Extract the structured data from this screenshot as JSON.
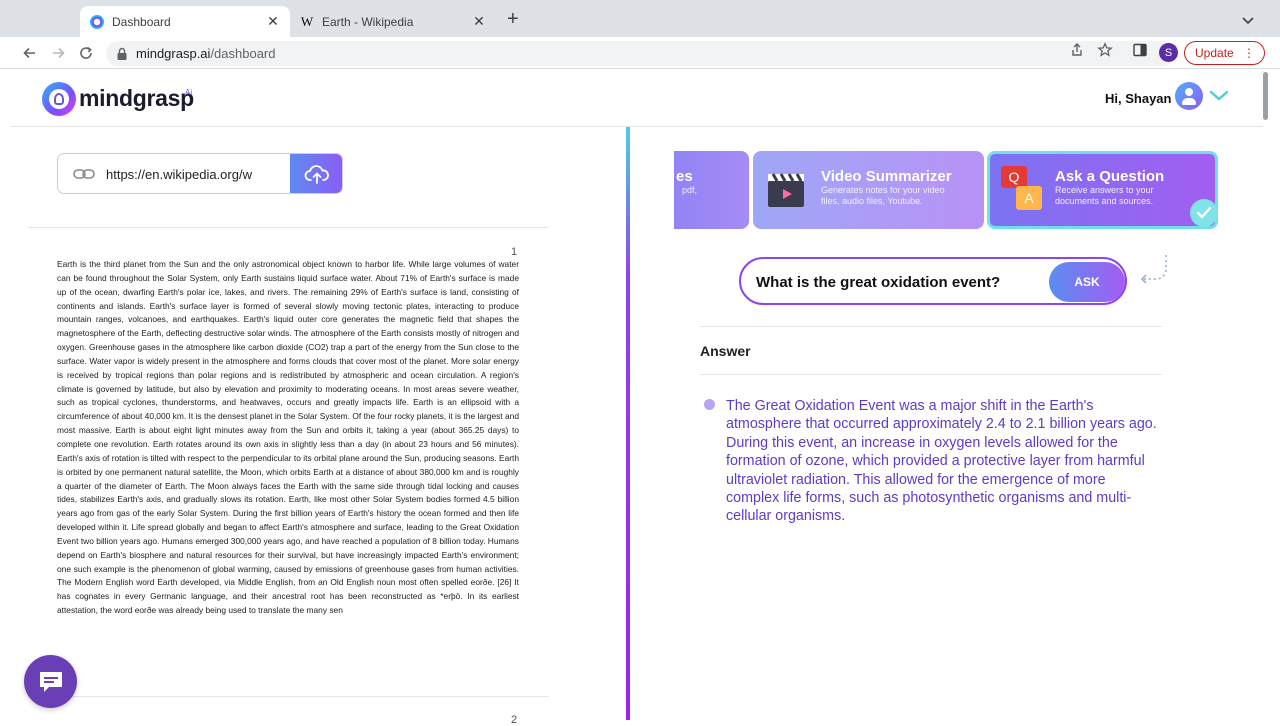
{
  "browser": {
    "tabs": [
      {
        "title": "Dashboard",
        "active": true
      },
      {
        "title": "Earth - Wikipedia",
        "active": false,
        "favicon_letter": "W"
      }
    ],
    "url_host": "mindgrasp.ai",
    "url_path": "/dashboard",
    "profile_initial": "S",
    "update_label": "Update",
    "update_menu": "⋮",
    "new_tab": "+",
    "close_glyph": "✕"
  },
  "header": {
    "logo_text": "mindgrasp",
    "logo_badge": "Ai",
    "greeting": "Hi, Shayan"
  },
  "left": {
    "url_input_value": "https://en.wikipedia.org/w",
    "page_number": "1",
    "next_page_number": "2",
    "document_text": "Earth is the third planet from the Sun and the only astronomical object known to harbor life. While large volumes of water can be found throughout the Solar System, only Earth sustains liquid surface water. About 71% of Earth's surface is made up of the ocean, dwarfing Earth's polar ice, lakes, and rivers. The remaining 29% of Earth's surface is land, consisting of continents and islands. Earth's surface layer is formed of several slowly moving tectonic plates, interacting to produce mountain ranges, volcanoes, and earthquakes. Earth's liquid outer core generates the magnetic field that shapes the magnetosphere of the Earth, deflecting destructive solar winds. The atmosphere of the Earth consists mostly of nitrogen and oxygen. Greenhouse gases in the atmosphere like carbon dioxide (CO2) trap a part of the energy from the Sun close to the surface. Water vapor is widely present in the atmosphere and forms clouds that cover most of the planet. More solar energy is received by tropical regions than polar regions and is redistributed by atmospheric and ocean circulation. A region's climate is governed by latitude, but also by elevation and proximity to moderating oceans. In most areas severe weather, such as tropical cyclones, thunderstorms, and heatwaves, occurs and greatly impacts life. Earth is an ellipsoid with a circumference of about 40,000 km. It is the densest planet in the Solar System. Of the four rocky planets, it is the largest and most massive. Earth is about eight light minutes away from the Sun and orbits it, taking a year (about 365.25 days) to complete one revolution. Earth rotates around its own axis in slightly less than a day (in about 23 hours and 56 minutes). Earth's axis of rotation is tilted with respect to the perpendicular to its orbital plane around the Sun, producing seasons. Earth is orbited by one permanent natural satellite, the Moon, which orbits Earth at a distance of about 380,000 km and is roughly a quarter of the diameter of Earth. The Moon always faces the Earth with the same side through tidal locking and causes tides, stabilizes Earth's axis, and gradually slows its rotation. Earth, like most other Solar System bodies formed 4.5 billion years ago from gas of the early Solar System. During the first billion years of Earth's history the ocean formed and then life developed within it. Life spread globally and began to affect Earth's atmosphere and surface, leading to the Great Oxidation Event two billion years ago. Humans emerged 300,000 years ago, and have reached a population of 8 billion today. Humans depend on Earth's biosphere and natural resources for their survival, but have increasingly impacted Earth's environment; one such example is the phenomenon of global warming, caused by emissions of greenhouse gases from human activities. The Modern English word Earth developed, via Middle English, from an Old English noun most often spelled eorðe. [26] It has cognates in every Germanic language, and their ancestral root has been reconstructed as *erþō. In its earliest attestation, the word eorðe was already being used to translate the many sen"
  },
  "tools": [
    {
      "title": "es",
      "description": "pdf,",
      "partial": true
    },
    {
      "title": "Video Summarizer",
      "description": "Generates notes for your video files, audio files, Youtube."
    },
    {
      "title": "Ask a Question",
      "description": "Receive answers to your documents and sources.",
      "selected": true,
      "icon_q": "Q",
      "icon_a": "A"
    }
  ],
  "ask": {
    "question": "What is the great oxidation event?",
    "button_label": "ASK"
  },
  "answer": {
    "heading": "Answer",
    "text": "The Great Oxidation Event was a major shift in the Earth's atmosphere that occurred approximately 2.4 to 2.1 billion years ago. During this event, an increase in oxygen levels allowed for the formation of ozone, which provided a protective layer from harmful ultraviolet radiation. This allowed for the emergence of more complex life forms, such as photosynthetic organisms and multi-cellular organisms."
  },
  "colors": {
    "accent_purple": "#8e44ec",
    "answer_text": "#5e3bc7",
    "update_red": "#c5221f",
    "chat_fab": "#6a3fb5"
  },
  "icons": [
    "dashboard-favicon",
    "wikipedia-favicon",
    "back-arrow-icon",
    "forward-arrow-icon",
    "reload-icon",
    "lock-icon",
    "share-icon",
    "star-icon",
    "sidebar-icon",
    "link-icon",
    "cloud-upload-icon",
    "chat-icon",
    "clapperboard-icon",
    "qa-icon",
    "check-icon",
    "chevron-down-icon"
  ]
}
